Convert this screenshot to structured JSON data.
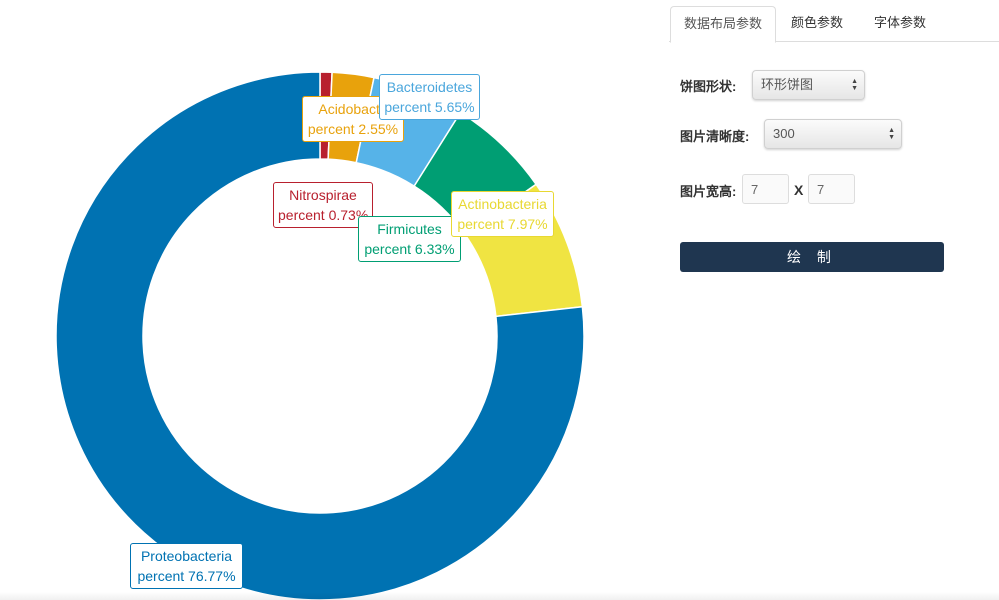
{
  "chart_data": {
    "type": "pie",
    "variant": "donut",
    "title": "",
    "series": [
      {
        "name": "Nitrospirae",
        "label": "Nitrospirae",
        "value": 0.73,
        "value_label": "percent 0.73%",
        "color": "#b8202e"
      },
      {
        "name": "Acidobacteria",
        "label": "Acidobacte",
        "value": 2.55,
        "value_label": "percent 2.55%",
        "color": "#e8a20c"
      },
      {
        "name": "Bacteroidetes",
        "label": "Bacteroidetes",
        "value": 5.65,
        "value_label": "percent 5.65%",
        "color": "#56b3e8"
      },
      {
        "name": "Firmicutes",
        "label": "Firmicutes",
        "value": 6.33,
        "value_label": "percent 6.33%",
        "color": "#009e73"
      },
      {
        "name": "Actinobacteria",
        "label": "Actinobacteria",
        "value": 7.97,
        "value_label": "percent 7.97%",
        "color": "#f0e442"
      },
      {
        "name": "Proteobacteria",
        "label": "Proteobacteria",
        "value": 76.77,
        "value_label": "percent 76.77%",
        "color": "#0072b2"
      }
    ]
  },
  "label_text_colors": {
    "Nitrospirae": "#b8202e",
    "Acidobacteria": "#e8a20c",
    "Bacteroidetes": "#4aa6dc",
    "Firmicutes": "#009e73",
    "Actinobacteria": "#e8d832",
    "Proteobacteria": "#0072b2"
  },
  "panel": {
    "tabs": [
      "数据布局参数",
      "颜色参数",
      "字体参数"
    ],
    "active_tab": 0,
    "shape_label": "饼图形状:",
    "shape_value": "环形饼图",
    "resolution_label": "图片清晰度:",
    "resolution_value": "300",
    "size_label": "图片宽高:",
    "width_value": "7",
    "height_value": "7",
    "size_separator": "X",
    "draw_button": "绘 制",
    "draw_button_color": "#1f3650"
  }
}
